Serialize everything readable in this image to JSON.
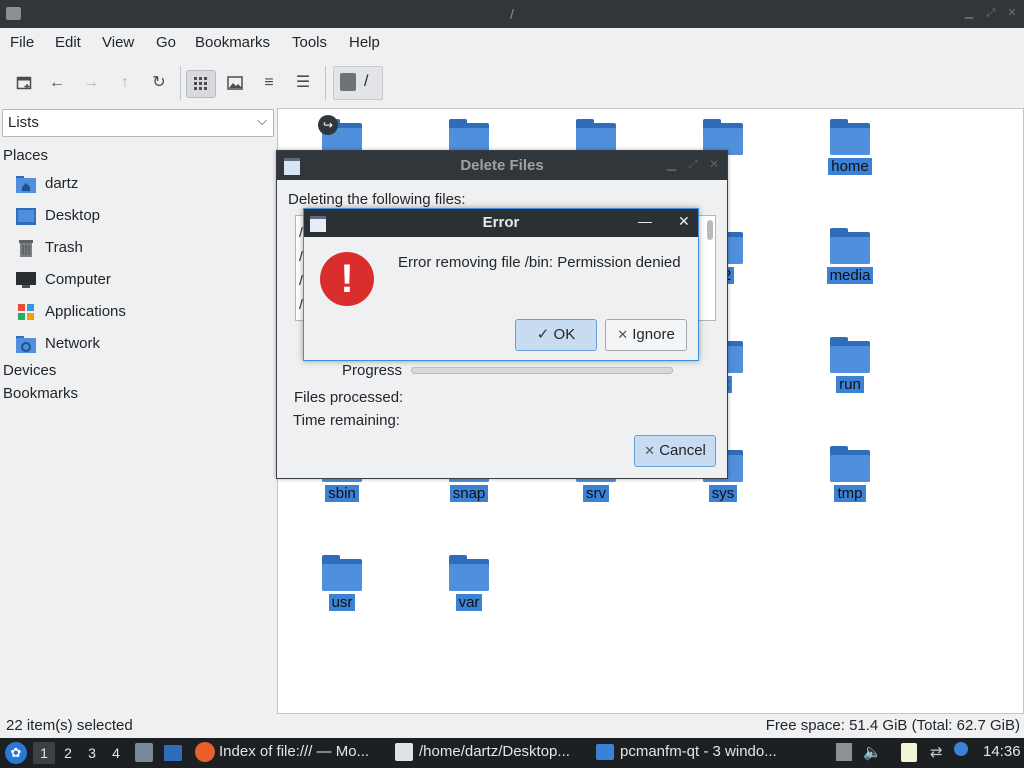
{
  "window": {
    "title": "/"
  },
  "menu": [
    "File",
    "Edit",
    "View",
    "Go",
    "Bookmarks",
    "Tools",
    "Help"
  ],
  "path": {
    "value": "/"
  },
  "sidebar": {
    "view_select": "Lists",
    "places_header": "Places",
    "places": [
      {
        "label": "dartz",
        "icon": "home-folder-icon"
      },
      {
        "label": "Desktop",
        "icon": "desktop-icon"
      },
      {
        "label": "Trash",
        "icon": "trash-icon"
      },
      {
        "label": "Computer",
        "icon": "computer-icon"
      },
      {
        "label": "Applications",
        "icon": "applications-icon"
      },
      {
        "label": "Network",
        "icon": "network-icon"
      }
    ],
    "devices_header": "Devices",
    "bookmarks_header": "Bookmarks"
  },
  "files": [
    {
      "name": ""
    },
    {
      "name": ""
    },
    {
      "name": ""
    },
    {
      "name": "t"
    },
    {
      "name": "home"
    },
    {
      "name": "32"
    },
    {
      "name": "media"
    },
    {
      "name": "st"
    },
    {
      "name": "run"
    },
    {
      "name": "sbin"
    },
    {
      "name": "snap"
    },
    {
      "name": "srv"
    },
    {
      "name": "sys"
    },
    {
      "name": "tmp"
    },
    {
      "name": "usr"
    },
    {
      "name": "var"
    }
  ],
  "status": {
    "selected": "22 item(s) selected",
    "free_space": "Free space: 51.4 GiB (Total: 62.7 GiB)"
  },
  "delete_dialog": {
    "title": "Delete Files",
    "heading": "Deleting the following files:",
    "list_fragments": [
      "/",
      "/",
      "/",
      "/"
    ],
    "progress_label": "Progress",
    "progress": 0,
    "files_processed_label": "Files processed:",
    "time_remaining_label": "Time remaining:",
    "cancel_label": "Cancel"
  },
  "error_dialog": {
    "title": "Error",
    "message": "Error removing file /bin: Permission denied",
    "ok_label": "OK",
    "ignore_label": "Ignore"
  },
  "taskbar": {
    "workspaces": [
      "1",
      "2",
      "3",
      "4"
    ],
    "tasks": [
      "Index of file:/// — Mo...",
      "/home/dartz/Desktop...",
      "pcmanfm-qt - 3 windo..."
    ],
    "clock": "14:36"
  },
  "colors": {
    "selection": "#3b82d6",
    "folder": "#4f8fdc",
    "error_red": "#da2d2d"
  }
}
